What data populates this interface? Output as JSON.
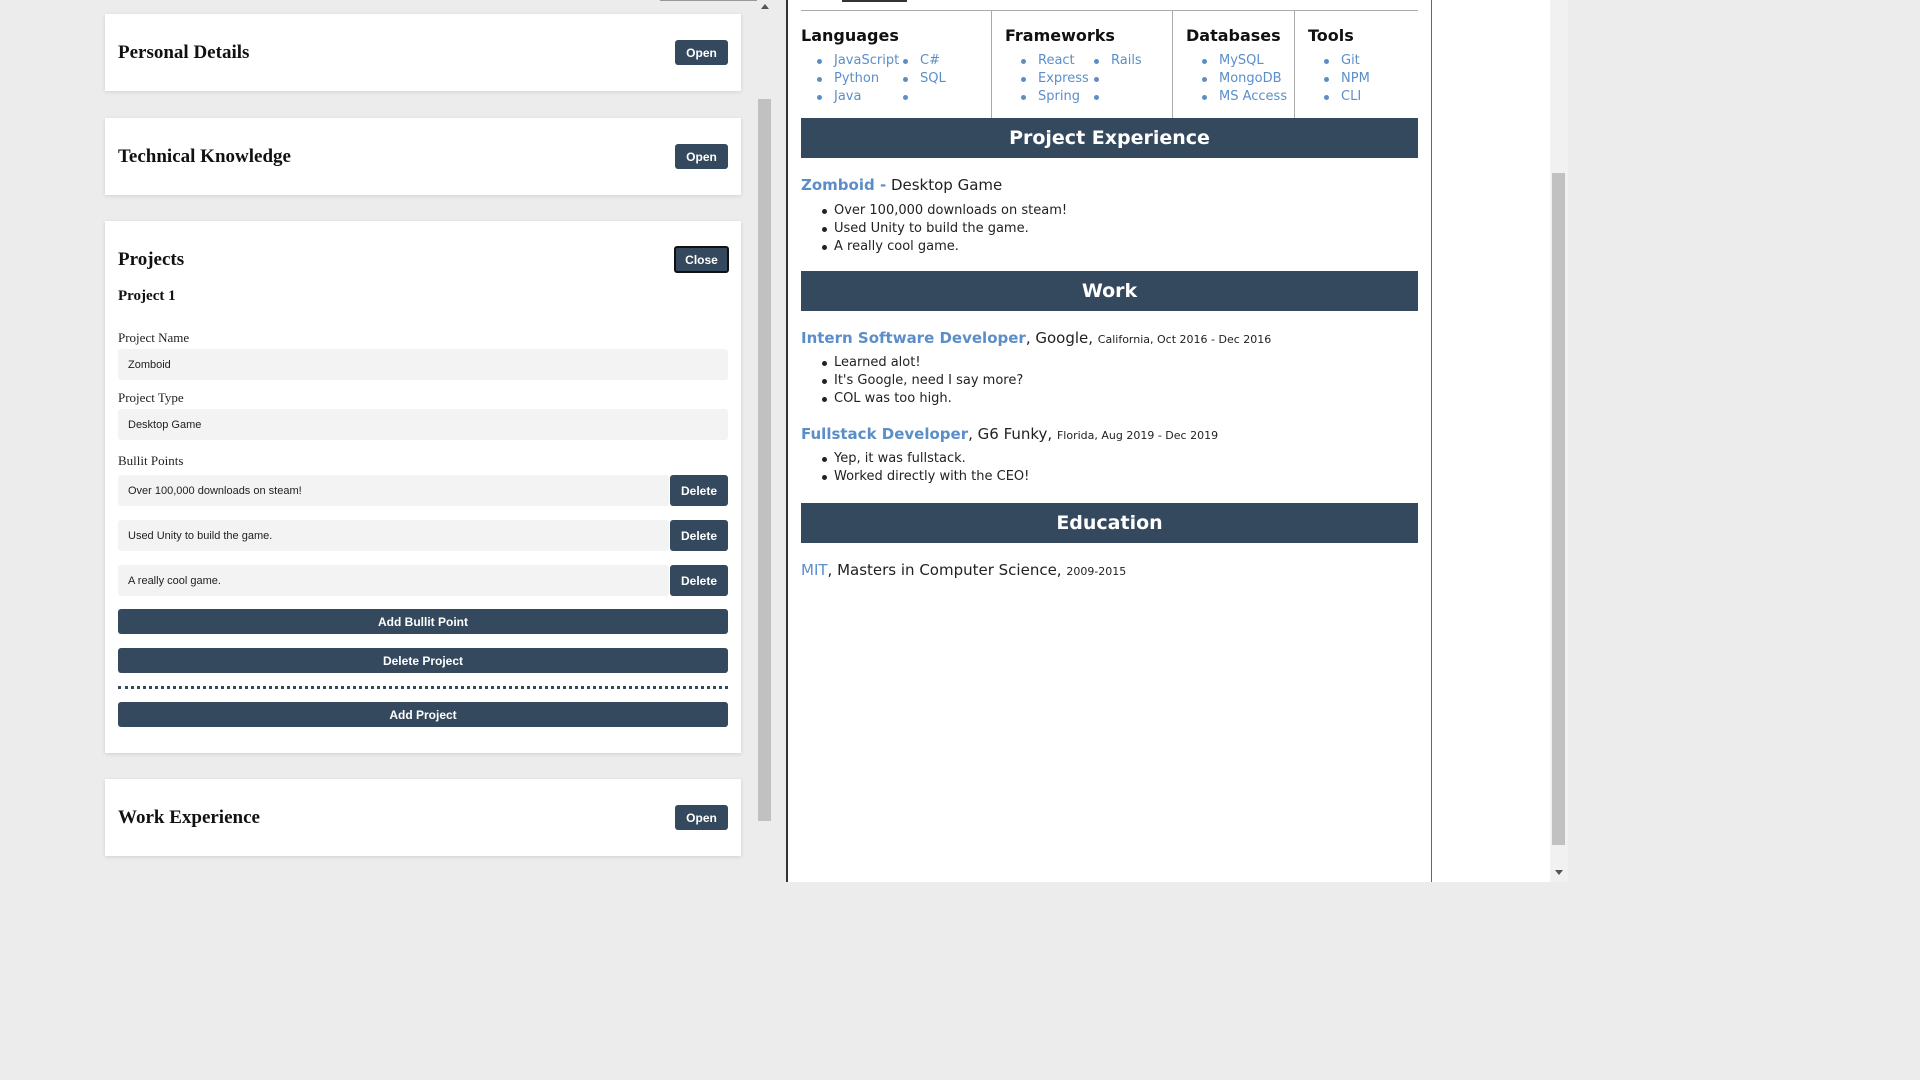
{
  "editor": {
    "personal": {
      "title": "Personal Details",
      "button": "Open"
    },
    "technical": {
      "title": "Technical Knowledge",
      "button": "Open"
    },
    "projects": {
      "title": "Projects",
      "button": "Close",
      "project_heading": "Project 1",
      "name_label": "Project Name",
      "name_value": "Zomboid",
      "type_label": "Project Type",
      "type_value": "Desktop Game",
      "bullets_label": "Bullit Points",
      "bullets": [
        "Over 100,000 downloads on steam!",
        "Used Unity to build the game.",
        "A really cool game."
      ],
      "delete_label": "Delete",
      "add_bullet": "Add Bullit Point",
      "delete_project": "Delete Project",
      "add_project": "Add Project"
    },
    "work": {
      "title": "Work Experience",
      "button": "Open"
    }
  },
  "preview": {
    "skills": [
      {
        "heading": "Languages",
        "col1": [
          "JavaScript",
          "Python",
          "Java"
        ],
        "col2": [
          "C#",
          "SQL",
          ""
        ]
      },
      {
        "heading": "Frameworks",
        "col1": [
          "React",
          "Express",
          "Spring"
        ],
        "col2": [
          "Rails",
          "",
          ""
        ]
      },
      {
        "heading": "Databases",
        "col1": [
          "MySQL",
          "MongoDB",
          "MS Access"
        ],
        "col2": []
      },
      {
        "heading": "Tools",
        "col1": [
          "Git",
          "NPM",
          "CLI"
        ],
        "col2": []
      }
    ],
    "project_section": "Project Experience",
    "project": {
      "name": "Zomboid -",
      "type": " Desktop Game",
      "bullets": [
        "Over 100,000 downloads on steam!",
        "Used Unity to build the game.",
        "A really cool game."
      ]
    },
    "work_section": "Work",
    "jobs": [
      {
        "title": "Intern Software Developer",
        "company": ", Google, ",
        "details": "California, Oct 2016 - Dec 2016",
        "bullets": [
          "Learned alot!",
          "It's Google, need I say more?",
          "COL was too high."
        ]
      },
      {
        "title": "Fullstack Developer",
        "company": ", G6 Funky, ",
        "details": "Florida, Aug 2019 - Dec 2019",
        "bullets": [
          "Yep, it was fullstack.",
          "Worked directly with the CEO!"
        ]
      }
    ],
    "education_section": "Education",
    "education": {
      "school": "MIT",
      "degree": ", Masters in Computer Science, ",
      "years": "2009-2015"
    }
  }
}
